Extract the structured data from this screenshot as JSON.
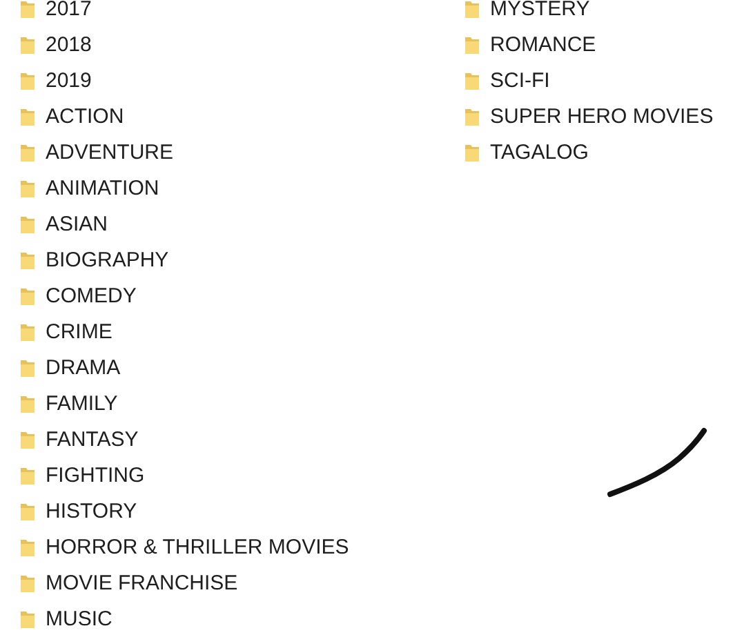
{
  "columns": [
    {
      "folders": [
        "2017",
        "2018",
        "2019",
        "ACTION",
        "ADVENTURE",
        "ANIMATION",
        "ASIAN",
        "BIOGRAPHY",
        "COMEDY",
        "CRIME",
        "DRAMA",
        "FAMILY",
        "FANTASY",
        "FIGHTING",
        "HISTORY",
        "HORROR & THRILLER MOVIES",
        "MOVIE FRANCHISE",
        "MUSIC"
      ]
    },
    {
      "folders": [
        "MYSTERY",
        "ROMANCE",
        "SCI-FI",
        "SUPER HERO MOVIES",
        "TAGALOG"
      ]
    }
  ]
}
